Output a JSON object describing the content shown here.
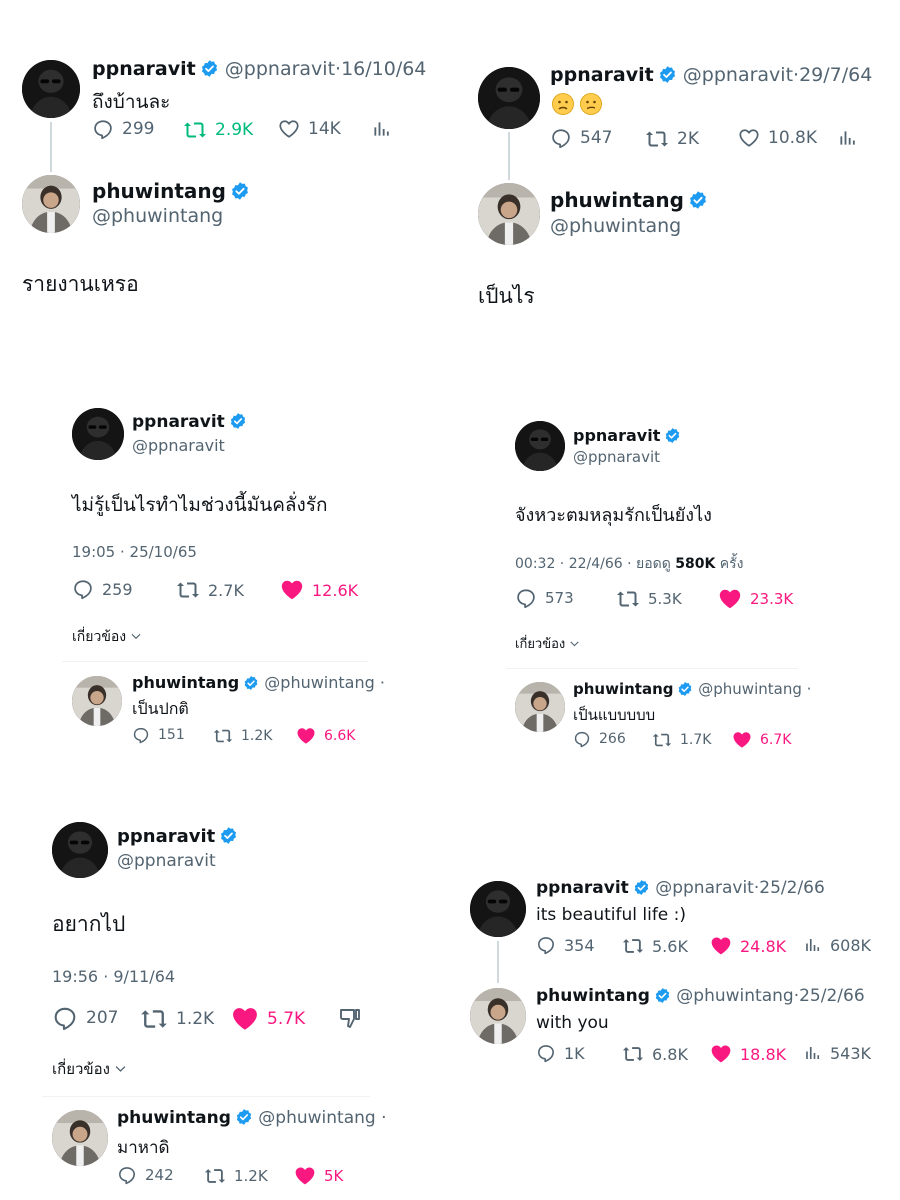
{
  "colors": {
    "accent": "#1d9bf0",
    "like": "#f91880",
    "retweet": "#00ba7c",
    "muted": "#536471"
  },
  "t1": {
    "author": "ppnaravit",
    "handle": "@ppnaravit",
    "sep": "·",
    "date": "16/10/64",
    "text": "ถึงบ้านละ",
    "replies": "299",
    "retweets": "2.9K",
    "likes": "14K",
    "reply_author": "phuwintang",
    "reply_handle": "@phuwintang",
    "reply_text": "รายงานเหรอ"
  },
  "t2": {
    "author": "ppnaravit",
    "handle": "@ppnaravit",
    "sep": "·",
    "date": "29/7/64",
    "emojis": [
      "slightly-frowning-face",
      "confused-face"
    ],
    "replies": "547",
    "retweets": "2K",
    "likes": "10.8K",
    "reply_author": "phuwintang",
    "reply_handle": "@phuwintang",
    "reply_text": "เป็นไร"
  },
  "t3": {
    "author": "ppnaravit",
    "handle": "@ppnaravit",
    "text": "ไม่รู้เป็นไรทำไมช่วงนี้มันคลั่งรัก",
    "timestamp": "19:05 · 25/10/65",
    "replies": "259",
    "retweets": "2.7K",
    "likes": "12.6K",
    "related": "เกี่ยวข้อง",
    "reply_author": "phuwintang",
    "reply_handle": "@phuwintang ·",
    "reply_text": "เป็นปกติ",
    "reply_replies": "151",
    "reply_retweets": "1.2K",
    "reply_likes": "6.6K"
  },
  "t4": {
    "author": "ppnaravit",
    "handle": "@ppnaravit",
    "text": "จังหวะตมหลุมรักเป็นยังไง",
    "timestamp": "00:32 · 22/4/66 · ยอดดู ",
    "views": "580K",
    "views_suffix": " ครั้ง",
    "replies": "573",
    "retweets": "5.3K",
    "likes": "23.3K",
    "related": "เกี่ยวข้อง",
    "reply_author": "phuwintang",
    "reply_handle": "@phuwintang ·",
    "reply_text": "เป็นแบบบบบ",
    "reply_replies": "266",
    "reply_retweets": "1.7K",
    "reply_likes": "6.7K"
  },
  "t5": {
    "author": "ppnaravit",
    "handle": "@ppnaravit",
    "text": "อยากไป",
    "timestamp": "19:56 · 9/11/64",
    "replies": "207",
    "retweets": "1.2K",
    "likes": "5.7K",
    "related": "เกี่ยวข้อง",
    "reply_author": "phuwintang",
    "reply_handle": "@phuwintang ·",
    "reply_text": "มาหาดิ",
    "reply_replies": "242",
    "reply_retweets": "1.2K",
    "reply_likes": "5K"
  },
  "t6": {
    "author": "ppnaravit",
    "handle": "@ppnaravit",
    "sep": "·",
    "date": "25/2/66",
    "text": "its beautiful life :)",
    "replies": "354",
    "retweets": "5.6K",
    "likes": "24.8K",
    "views": "608K",
    "reply_author": "phuwintang",
    "reply_handle": "@phuwintang",
    "reply_date": "25/2/66",
    "reply_text": "with you",
    "reply_replies": "1K",
    "reply_retweets": "6.8K",
    "reply_likes": "18.8K",
    "reply_views": "543K"
  }
}
